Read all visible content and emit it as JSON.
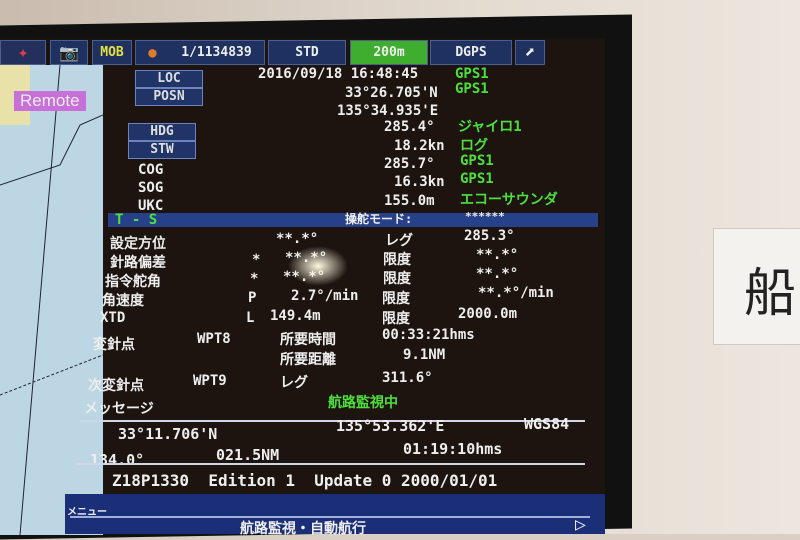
{
  "topbar": {
    "scale": "1/1134839",
    "mode": "STD",
    "range": "200m",
    "positioning": "DGPS",
    "mob": "MOB",
    "remote": "Remote"
  },
  "position": {
    "loc_btn": "LOC",
    "posn_btn": "POSN",
    "datetime": "2016/09/18 16:48:45",
    "datetime_src": "GPS1",
    "lat": "33°26.705'N",
    "lat_src": "GPS1",
    "lon": "135°34.935'E"
  },
  "nav": [
    {
      "label": "HDG",
      "value": "285.4°",
      "src": "ジャイロ1",
      "button": true
    },
    {
      "label": "STW",
      "value": "18.2kn",
      "src": "ログ",
      "button": true
    },
    {
      "label": "COG",
      "value": "285.7°",
      "src": "GPS1",
      "button": false
    },
    {
      "label": "SOG",
      "value": "16.3kn",
      "src": "GPS1",
      "button": false
    },
    {
      "label": "UKC",
      "value": "155.0m",
      "src": "エコーサウンダ",
      "button": false
    }
  ],
  "ts": {
    "title": "T - S",
    "mode_label": "操舵モード:",
    "mode_value": "******"
  },
  "steer": [
    {
      "label": "設定方位",
      "flag": "",
      "value": "**.*°",
      "sub": "レグ",
      "subval": "285.3°"
    },
    {
      "label": "針路偏差",
      "flag": "*",
      "value": "**.*°",
      "sub": "限度",
      "subval": "**.*°"
    },
    {
      "label": "指令舵角",
      "flag": "*",
      "value": "**.*°",
      "sub": "限度",
      "subval": "**.*°"
    },
    {
      "label": "角速度",
      "flag": "P",
      "value": "2.7°/min",
      "sub": "限度",
      "subval": "**.*°/min"
    },
    {
      "label": "XTD",
      "flag": "L",
      "value": "149.4m",
      "sub": "限度",
      "subval": "2000.0m"
    }
  ],
  "waypoint": {
    "label": "変針点",
    "wpt": "WPT8",
    "time_label": "所要時間",
    "time": "00:33:21hms",
    "dist_label": "所要距離",
    "dist": "9.1NM",
    "next_label": "次変針点",
    "next_wpt": "WPT9",
    "leg_label": "レグ",
    "leg": "311.6°"
  },
  "message": {
    "label": "メッセージ",
    "text": "航路監視中"
  },
  "cursor": {
    "lat": "33°11.706'N",
    "lon": "135°53.362'E",
    "datum": "WGS84",
    "bearing": "134.0°",
    "range": "021.5NM",
    "ttg": "01:19:10hms"
  },
  "chart": {
    "info": "Z18P1330  Edition 1  Update 0 2000/01/01"
  },
  "menu": {
    "label": "メニュー",
    "item": "航路監視・自動航行"
  },
  "sign": {
    "text": "船"
  },
  "colors": {
    "accent_green": "#4de03c",
    "panel_blue": "#1e3160",
    "background": "#1d1410"
  }
}
